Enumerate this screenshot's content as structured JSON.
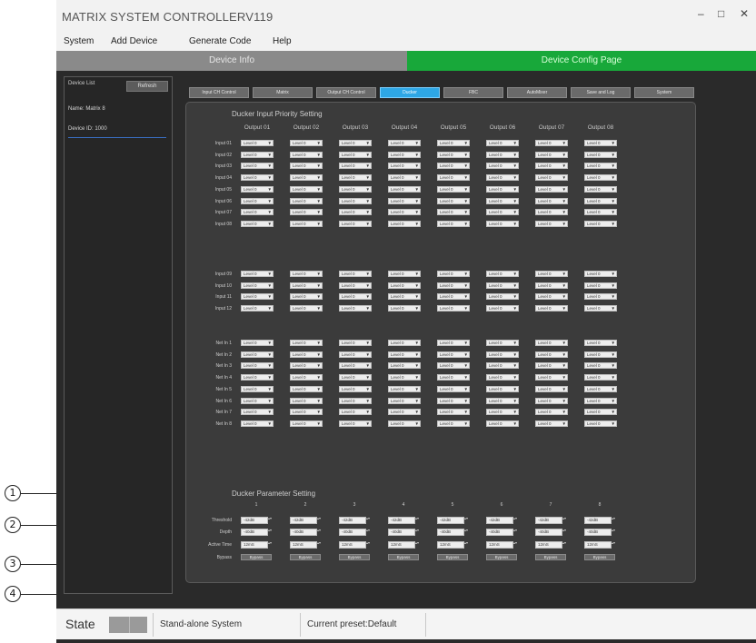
{
  "callouts": [
    "1",
    "2",
    "3",
    "4"
  ],
  "window": {
    "title": "MATRIX SYSTEM CONTROLLERV119",
    "controls": {
      "minimize": "–",
      "maximize": "□",
      "close": "✕"
    }
  },
  "menu": [
    "System",
    "Add Device",
    "Generate Code",
    "Help"
  ],
  "page_tabs": {
    "left": "Device Info",
    "right": "Device Config Page",
    "active_color": "#18a83a"
  },
  "device_panel": {
    "list_label": "Device List",
    "refresh_label": "Refresh",
    "name": "Name: Matrix 8",
    "id": "Device ID: 1000"
  },
  "config_tabs": [
    "Input CH Control",
    "Matrix",
    "Output CH Control",
    "Ducker",
    "FBC",
    "AutoMixer",
    "Save and Log",
    "System"
  ],
  "active_config_tab": 3,
  "ducker_priority": {
    "title": "Ducker Input Priority Setting",
    "columns": [
      "Output 01",
      "Output 02",
      "Output 03",
      "Output 04",
      "Output 05",
      "Output 06",
      "Output 07",
      "Output 08"
    ],
    "row_groups": [
      [
        "Input 01",
        "Input 02",
        "Input 03",
        "Input 04",
        "Input 05",
        "Input 06",
        "Input 07",
        "Input 08"
      ],
      [
        "Input 09",
        "Input 10",
        "Input 11",
        "Input 12"
      ],
      [
        "Net In 1",
        "Net In 2",
        "Net In 3",
        "Net In 4",
        "Net In 5",
        "Net In 6",
        "Net In 7",
        "Net In 8"
      ]
    ],
    "cell_value": "Level 0",
    "dropdown_arrow": "▼"
  },
  "ducker_params": {
    "title": "Ducker Parameter Setting",
    "columns": [
      "1",
      "2",
      "3",
      "4",
      "5",
      "6",
      "7",
      "8"
    ],
    "rows": {
      "threshold": {
        "label": "Threshold",
        "value": "-42dB"
      },
      "depth": {
        "label": "Depth",
        "value": "-40dB"
      },
      "active_time": {
        "label": "Active Time",
        "value": "12mS"
      },
      "bypass": {
        "label": "Bypass",
        "button": "Bypass"
      }
    }
  },
  "status": {
    "state_label": "State",
    "state_color": "#9a9a9a",
    "system_mode": "Stand-alone System",
    "current_preset": "Current preset:Default"
  }
}
